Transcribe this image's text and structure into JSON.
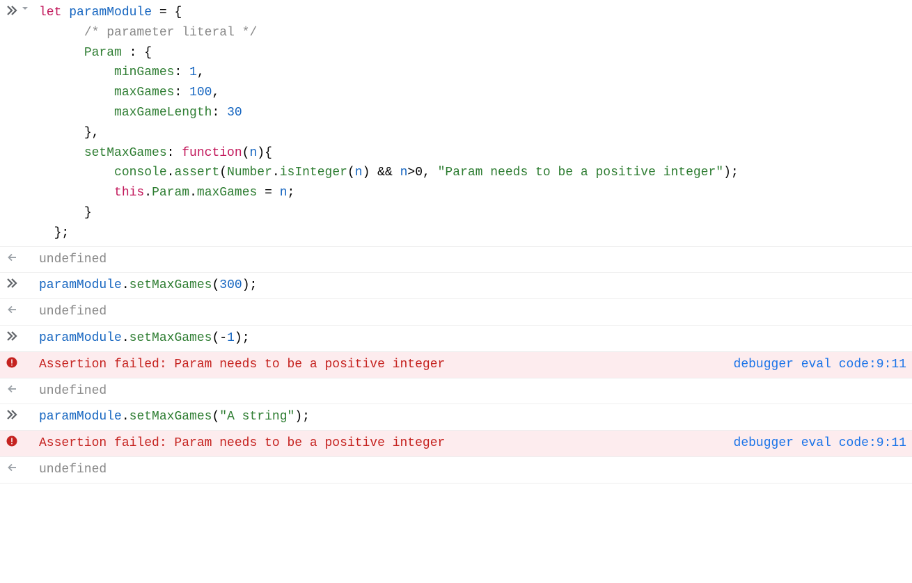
{
  "rows": [
    {
      "kind": "input-multi",
      "code": {
        "l1_let": "let",
        "l1_var": "paramModule",
        "l1_eq": " = {",
        "l2_comment": "/* parameter literal */",
        "l3_param": "Param",
        "l3_colonBrace": " : {",
        "l4_prop": "minGames",
        "l4_val": "1",
        "l5_prop": "maxGames",
        "l5_val": "100",
        "l6_prop": "maxGameLength",
        "l6_val": "30",
        "l7_close": "},",
        "l8_prop": "setMaxGames",
        "l8_func": "function",
        "l8_param": "n",
        "l9_console": "console",
        "l9_assert": "assert",
        "l9_number": "Number",
        "l9_isint": "isInteger",
        "l9_n1": "n",
        "l9_and": " && ",
        "l9_n2": "n",
        "l9_gt0": ">0",
        "l9_comma": ", ",
        "l9_str": "\"Param needs to be a positive integer\"",
        "l9_tail": ");",
        "l9_wrap": "integer\");",
        "l10_this": "this",
        "l10_param": "Param",
        "l10_max": "maxGames",
        "l10_eq": " = ",
        "l10_n": "n",
        "l10_semi": ";",
        "l11_close": "}",
        "l12_close": "};"
      }
    },
    {
      "kind": "output",
      "text": "undefined"
    },
    {
      "kind": "input",
      "code": {
        "obj": "paramModule",
        "method": "setMaxGames",
        "arg": "300",
        "sign": ""
      }
    },
    {
      "kind": "output",
      "text": "undefined"
    },
    {
      "kind": "input",
      "code": {
        "obj": "paramModule",
        "method": "setMaxGames",
        "arg": "1",
        "sign": "-"
      }
    },
    {
      "kind": "error",
      "message": "Assertion failed: Param needs to be a positive integer",
      "source": "debugger eval code",
      "loc": "9:11"
    },
    {
      "kind": "output",
      "text": "undefined"
    },
    {
      "kind": "input-str",
      "code": {
        "obj": "paramModule",
        "method": "setMaxGames",
        "arg": "\"A string\""
      }
    },
    {
      "kind": "error",
      "message": "Assertion failed: Param needs to be a positive integer",
      "source": "debugger eval code",
      "loc": "9:11"
    },
    {
      "kind": "output",
      "text": "undefined"
    }
  ]
}
